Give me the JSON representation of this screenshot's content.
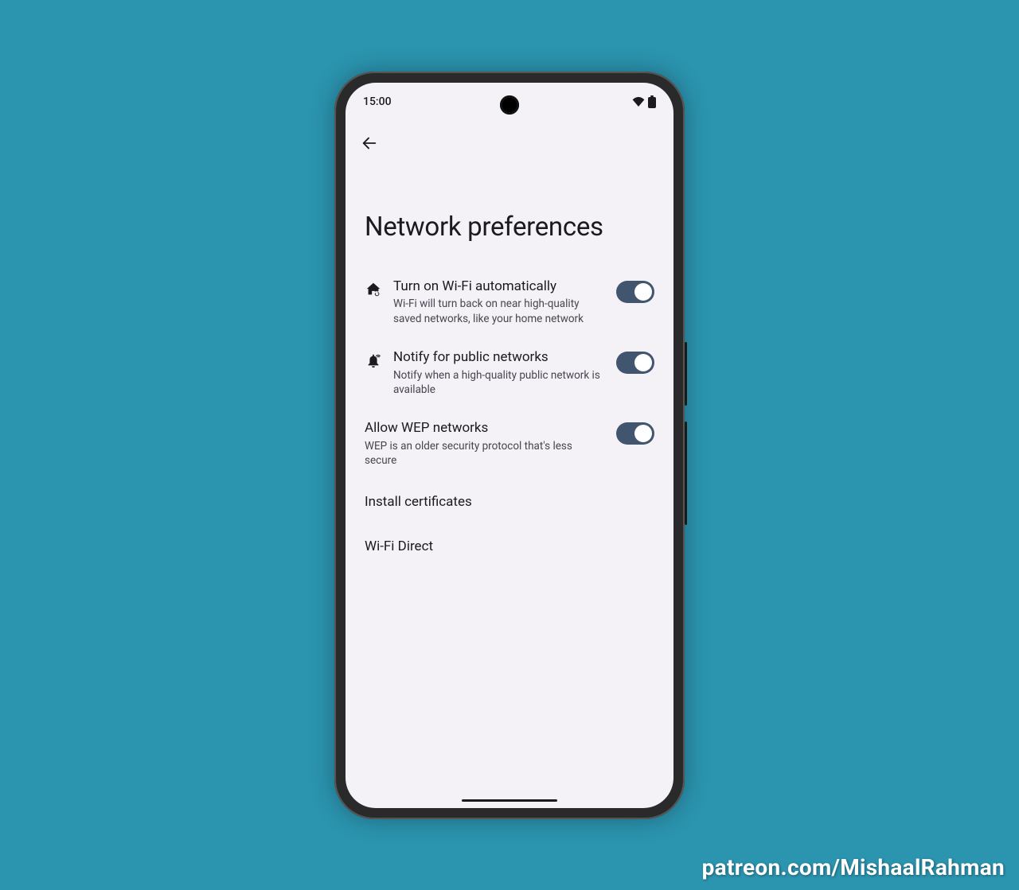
{
  "status": {
    "time": "15:00"
  },
  "page": {
    "title": "Network preferences"
  },
  "settings": {
    "auto_wifi": {
      "title": "Turn on Wi-Fi automatically",
      "desc": "Wi-Fi will turn back on near high-quality saved networks, like your home network",
      "enabled": true
    },
    "notify_public": {
      "title": "Notify for public networks",
      "desc": "Notify when a high-quality public network is available",
      "enabled": true
    },
    "allow_wep": {
      "title": "Allow WEP networks",
      "desc": "WEP is an older security protocol that's less secure",
      "enabled": true
    },
    "install_certs": {
      "title": "Install certificates"
    },
    "wifi_direct": {
      "title": "Wi-Fi Direct"
    }
  },
  "credit": "patreon.com/MishaalRahman"
}
